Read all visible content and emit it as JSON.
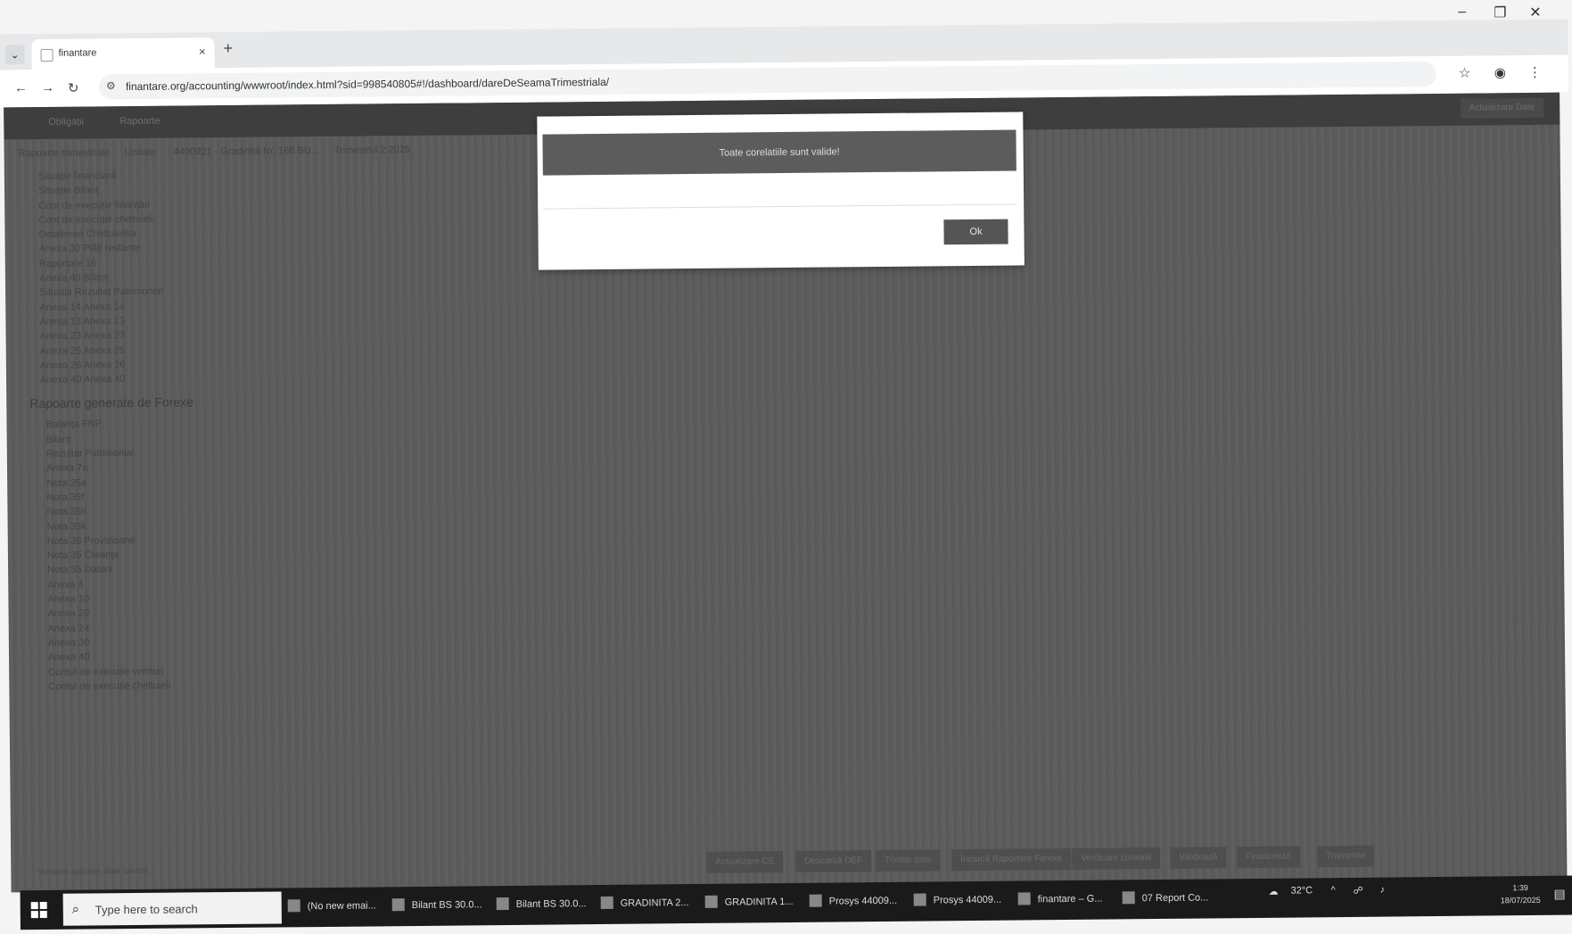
{
  "browser": {
    "tab_title": "finantare",
    "tab_close": "×",
    "new_tab": "+",
    "tab_list": "⌄",
    "url": "finantare.org/accounting/wwwroot/index.html?sid=998540805#!/dashboard/dareDeSeamaTrimestriala/",
    "window_controls": {
      "minimize": "–",
      "maximize": "❐",
      "close": "✕"
    }
  },
  "app": {
    "nav": {
      "item1": "Obligații",
      "item2": "Rapoarte",
      "right_button": "Actualizare Date"
    },
    "filters": {
      "type": "Rapoarte trimestriale",
      "unit_label": "Unitate:",
      "unit": "4400921 - Gradinita Nr. 168 BU...",
      "period": "Trimestrul 2 2025"
    },
    "sidebar": {
      "items": [
        "Situație financiară",
        "Situație Bilanț",
        "Cont de execuție finanțări",
        "Cont de execuție cheltuieli",
        "Detalierea Cheltuielilor",
        "Anexa 30 Plăți restante",
        "Raportare 16",
        "Anexa 40 Bilanț",
        "Situația Rezultat Patrimonial",
        "Anexa 14 Anexa 14",
        "Anexa 13 Anexa 13",
        "Anexa 23 Anexa 23",
        "Anexa 25 Anexa 25",
        "Anexa 26 Anexa 26",
        "Anexa 40 Anexa 40"
      ],
      "reports_header": "Rapoarte generate de Forexe",
      "reports": [
        "Balanța FNP",
        "Bilanț",
        "Rezultat Patrimonial",
        "Anexa 7a",
        "Nota 35a",
        "Nota 35f",
        "Nota 35h",
        "Nota 35k",
        "Nota 35 Provizioane",
        "Nota 35 Creanțe",
        "Nota 35 Datorii",
        "Anexa 4",
        "Anexa 10",
        "Anexa 20",
        "Anexa 24",
        "Anexa 30",
        "Anexa 40",
        "Contul de execuție venituri",
        "Contul de execuție cheltuieli"
      ]
    },
    "bottom": {
      "note": "Versiune aplicație: date salvate",
      "buttons": [
        "Actualizare CE",
        "Descarcă DEF",
        "Trimite date",
        "Încarcă Raportare Forexe",
        "Verificare corelații",
        "Validează",
        "Finalizează",
        "Transmite"
      ]
    }
  },
  "modal": {
    "message": "Toate corelatiile sunt valide!",
    "ok_label": "Ok"
  },
  "taskbar": {
    "search_placeholder": "Type here to search",
    "items": [
      "(No new emai...",
      "Bilant BS 30.0...",
      "Bilant BS 30.0...",
      "GRADINITA 2...",
      "GRADINITA 1...",
      "Prosys 44009...",
      "Prosys 44009...",
      "finantare – G...",
      "07 Report Co..."
    ],
    "temperature": "32°C",
    "time": "1:39",
    "date": "18/07/2025"
  }
}
